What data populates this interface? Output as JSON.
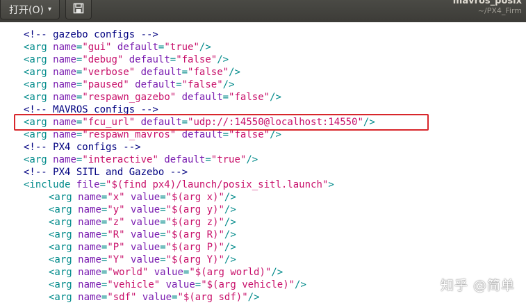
{
  "toolbar": {
    "open_label": "打开(O)",
    "open_caret": "▾",
    "save_icon": "save-icon"
  },
  "window": {
    "title": "mavros_posix",
    "subtitle": "~/PX4_Firm"
  },
  "code_lines": [
    {
      "indent": 0,
      "parts": [
        {
          "k": "c",
          "s": "<!-- gazebo configs -->"
        }
      ]
    },
    {
      "indent": 0,
      "parts": [
        {
          "k": "t",
          "s": "<arg "
        },
        {
          "k": "a",
          "s": "name"
        },
        {
          "k": "p",
          "s": "="
        },
        {
          "k": "v",
          "s": "\"gui\""
        },
        {
          "k": "a",
          "s": " default"
        },
        {
          "k": "p",
          "s": "="
        },
        {
          "k": "v",
          "s": "\"true\""
        },
        {
          "k": "t",
          "s": "/>"
        }
      ]
    },
    {
      "indent": 0,
      "parts": [
        {
          "k": "t",
          "s": "<arg "
        },
        {
          "k": "a",
          "s": "name"
        },
        {
          "k": "p",
          "s": "="
        },
        {
          "k": "v",
          "s": "\"debug\""
        },
        {
          "k": "a",
          "s": " default"
        },
        {
          "k": "p",
          "s": "="
        },
        {
          "k": "v",
          "s": "\"false\""
        },
        {
          "k": "t",
          "s": "/>"
        }
      ]
    },
    {
      "indent": 0,
      "parts": [
        {
          "k": "t",
          "s": "<arg "
        },
        {
          "k": "a",
          "s": "name"
        },
        {
          "k": "p",
          "s": "="
        },
        {
          "k": "v",
          "s": "\"verbose\""
        },
        {
          "k": "a",
          "s": " default"
        },
        {
          "k": "p",
          "s": "="
        },
        {
          "k": "v",
          "s": "\"false\""
        },
        {
          "k": "t",
          "s": "/>"
        }
      ]
    },
    {
      "indent": 0,
      "parts": [
        {
          "k": "t",
          "s": "<arg "
        },
        {
          "k": "a",
          "s": "name"
        },
        {
          "k": "p",
          "s": "="
        },
        {
          "k": "v",
          "s": "\"paused\""
        },
        {
          "k": "a",
          "s": " default"
        },
        {
          "k": "p",
          "s": "="
        },
        {
          "k": "v",
          "s": "\"false\""
        },
        {
          "k": "t",
          "s": "/>"
        }
      ]
    },
    {
      "indent": 0,
      "parts": [
        {
          "k": "t",
          "s": "<arg "
        },
        {
          "k": "a",
          "s": "name"
        },
        {
          "k": "p",
          "s": "="
        },
        {
          "k": "v",
          "s": "\"respawn_gazebo\""
        },
        {
          "k": "a",
          "s": " default"
        },
        {
          "k": "p",
          "s": "="
        },
        {
          "k": "v",
          "s": "\"false\""
        },
        {
          "k": "t",
          "s": "/>"
        }
      ]
    },
    {
      "indent": 0,
      "parts": [
        {
          "k": "c",
          "s": "<!-- MAVROS configs -->"
        }
      ]
    },
    {
      "indent": 0,
      "parts": [
        {
          "k": "t",
          "s": "<arg "
        },
        {
          "k": "a",
          "s": "name"
        },
        {
          "k": "p",
          "s": "="
        },
        {
          "k": "v",
          "s": "\"fcu_url\""
        },
        {
          "k": "a",
          "s": " default"
        },
        {
          "k": "p",
          "s": "="
        },
        {
          "k": "v",
          "s": "\"udp://:14550@localhost:14550\""
        },
        {
          "k": "t",
          "s": "/>"
        }
      ]
    },
    {
      "indent": 0,
      "parts": [
        {
          "k": "t",
          "s": "<arg "
        },
        {
          "k": "a",
          "s": "name"
        },
        {
          "k": "p",
          "s": "="
        },
        {
          "k": "v",
          "s": "\"respawn_mavros\""
        },
        {
          "k": "a",
          "s": " default"
        },
        {
          "k": "p",
          "s": "="
        },
        {
          "k": "v",
          "s": "\"false\""
        },
        {
          "k": "t",
          "s": "/>"
        }
      ]
    },
    {
      "indent": 0,
      "parts": [
        {
          "k": "c",
          "s": "<!-- PX4 configs -->"
        }
      ]
    },
    {
      "indent": 0,
      "parts": [
        {
          "k": "t",
          "s": "<arg "
        },
        {
          "k": "a",
          "s": "name"
        },
        {
          "k": "p",
          "s": "="
        },
        {
          "k": "v",
          "s": "\"interactive\""
        },
        {
          "k": "a",
          "s": " default"
        },
        {
          "k": "p",
          "s": "="
        },
        {
          "k": "v",
          "s": "\"true\""
        },
        {
          "k": "t",
          "s": "/>"
        }
      ]
    },
    {
      "indent": 0,
      "parts": [
        {
          "k": "c",
          "s": "<!-- PX4 SITL and Gazebo -->"
        }
      ]
    },
    {
      "indent": 0,
      "parts": [
        {
          "k": "t",
          "s": "<include "
        },
        {
          "k": "a",
          "s": "file"
        },
        {
          "k": "p",
          "s": "="
        },
        {
          "k": "v",
          "s": "\"$(find px4)/launch/posix_sitl.launch\""
        },
        {
          "k": "t",
          "s": ">"
        }
      ]
    },
    {
      "indent": 1,
      "parts": [
        {
          "k": "t",
          "s": "<arg "
        },
        {
          "k": "a",
          "s": "name"
        },
        {
          "k": "p",
          "s": "="
        },
        {
          "k": "v",
          "s": "\"x\""
        },
        {
          "k": "a",
          "s": " value"
        },
        {
          "k": "p",
          "s": "="
        },
        {
          "k": "v",
          "s": "\"$(arg x)\""
        },
        {
          "k": "t",
          "s": "/>"
        }
      ]
    },
    {
      "indent": 1,
      "parts": [
        {
          "k": "t",
          "s": "<arg "
        },
        {
          "k": "a",
          "s": "name"
        },
        {
          "k": "p",
          "s": "="
        },
        {
          "k": "v",
          "s": "\"y\""
        },
        {
          "k": "a",
          "s": " value"
        },
        {
          "k": "p",
          "s": "="
        },
        {
          "k": "v",
          "s": "\"$(arg y)\""
        },
        {
          "k": "t",
          "s": "/>"
        }
      ]
    },
    {
      "indent": 1,
      "parts": [
        {
          "k": "t",
          "s": "<arg "
        },
        {
          "k": "a",
          "s": "name"
        },
        {
          "k": "p",
          "s": "="
        },
        {
          "k": "v",
          "s": "\"z\""
        },
        {
          "k": "a",
          "s": " value"
        },
        {
          "k": "p",
          "s": "="
        },
        {
          "k": "v",
          "s": "\"$(arg z)\""
        },
        {
          "k": "t",
          "s": "/>"
        }
      ]
    },
    {
      "indent": 1,
      "parts": [
        {
          "k": "t",
          "s": "<arg "
        },
        {
          "k": "a",
          "s": "name"
        },
        {
          "k": "p",
          "s": "="
        },
        {
          "k": "v",
          "s": "\"R\""
        },
        {
          "k": "a",
          "s": " value"
        },
        {
          "k": "p",
          "s": "="
        },
        {
          "k": "v",
          "s": "\"$(arg R)\""
        },
        {
          "k": "t",
          "s": "/>"
        }
      ]
    },
    {
      "indent": 1,
      "parts": [
        {
          "k": "t",
          "s": "<arg "
        },
        {
          "k": "a",
          "s": "name"
        },
        {
          "k": "p",
          "s": "="
        },
        {
          "k": "v",
          "s": "\"P\""
        },
        {
          "k": "a",
          "s": " value"
        },
        {
          "k": "p",
          "s": "="
        },
        {
          "k": "v",
          "s": "\"$(arg P)\""
        },
        {
          "k": "t",
          "s": "/>"
        }
      ]
    },
    {
      "indent": 1,
      "parts": [
        {
          "k": "t",
          "s": "<arg "
        },
        {
          "k": "a",
          "s": "name"
        },
        {
          "k": "p",
          "s": "="
        },
        {
          "k": "v",
          "s": "\"Y\""
        },
        {
          "k": "a",
          "s": " value"
        },
        {
          "k": "p",
          "s": "="
        },
        {
          "k": "v",
          "s": "\"$(arg Y)\""
        },
        {
          "k": "t",
          "s": "/>"
        }
      ]
    },
    {
      "indent": 1,
      "parts": [
        {
          "k": "t",
          "s": "<arg "
        },
        {
          "k": "a",
          "s": "name"
        },
        {
          "k": "p",
          "s": "="
        },
        {
          "k": "v",
          "s": "\"world\""
        },
        {
          "k": "a",
          "s": " value"
        },
        {
          "k": "p",
          "s": "="
        },
        {
          "k": "v",
          "s": "\"$(arg world)\""
        },
        {
          "k": "t",
          "s": "/>"
        }
      ]
    },
    {
      "indent": 1,
      "parts": [
        {
          "k": "t",
          "s": "<arg "
        },
        {
          "k": "a",
          "s": "name"
        },
        {
          "k": "p",
          "s": "="
        },
        {
          "k": "v",
          "s": "\"vehicle\""
        },
        {
          "k": "a",
          "s": " value"
        },
        {
          "k": "p",
          "s": "="
        },
        {
          "k": "v",
          "s": "\"$(arg vehicle)\""
        },
        {
          "k": "t",
          "s": "/>"
        }
      ]
    },
    {
      "indent": 1,
      "parts": [
        {
          "k": "t",
          "s": "<arg "
        },
        {
          "k": "a",
          "s": "name"
        },
        {
          "k": "p",
          "s": "="
        },
        {
          "k": "v",
          "s": "\"sdf\""
        },
        {
          "k": "a",
          "s": " value"
        },
        {
          "k": "p",
          "s": "="
        },
        {
          "k": "v",
          "s": "\"$(arg sdf)\""
        },
        {
          "k": "t",
          "s": "/>"
        }
      ]
    }
  ],
  "highlight_line": 7,
  "watermark": "知乎 @简单",
  "colors": {
    "comment": "#000080",
    "tag": "#008a8a",
    "attribute": "#7a1cb0",
    "value": "#c8106a",
    "highlight_border": "#d8262b"
  }
}
